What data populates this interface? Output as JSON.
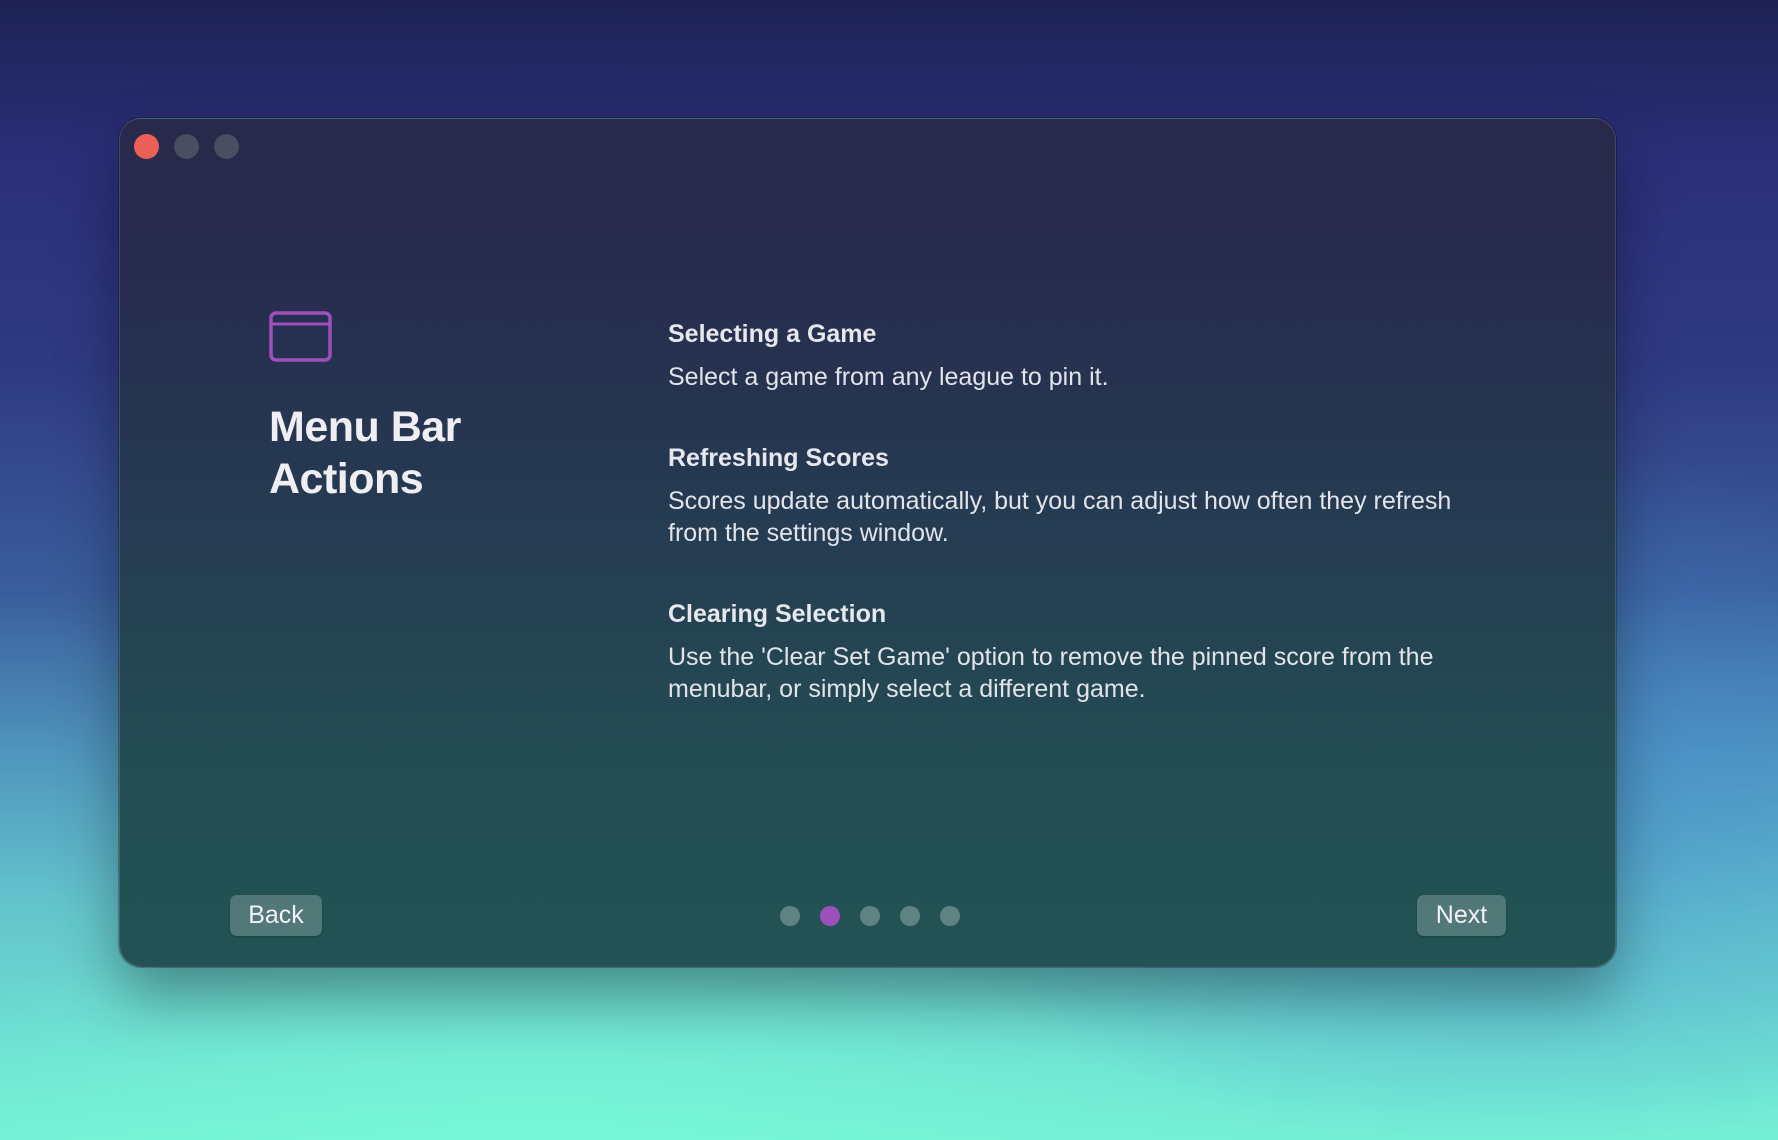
{
  "colors": {
    "accent": "#9f4fbc",
    "close": "#ec5f57",
    "inactive_traffic": "#4b4d61"
  },
  "window": {
    "traffic_lights": [
      "close",
      "minimize",
      "zoom"
    ]
  },
  "hero": {
    "icon": "window-icon",
    "title": "Menu Bar Actions"
  },
  "sections": [
    {
      "title": "Selecting a Game",
      "body": "Select a game from any league to pin it."
    },
    {
      "title": "Refreshing Scores",
      "body": "Scores update automatically, but you can adjust how often they refresh from the settings window."
    },
    {
      "title": "Clearing Selection",
      "body": "Use the 'Clear Set Game' option to remove the pinned score from the menubar, or simply select a different game."
    }
  ],
  "footer": {
    "back_label": "Back",
    "next_label": "Next",
    "page_count": 5,
    "current_page": 2
  }
}
